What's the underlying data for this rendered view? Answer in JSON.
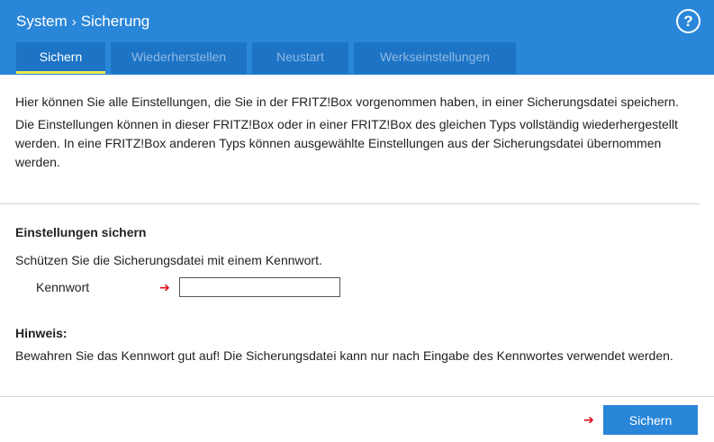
{
  "header": {
    "breadcrumb": [
      "System",
      "Sicherung"
    ],
    "help_glyph": "?"
  },
  "tabs": [
    {
      "label": "Sichern",
      "active": true
    },
    {
      "label": "Wiederherstellen",
      "active": false
    },
    {
      "label": "Neustart",
      "active": false
    },
    {
      "label": "Werkseinstellungen",
      "active": false
    }
  ],
  "intro": {
    "p1": "Hier können Sie alle Einstellungen, die Sie in der FRITZ!Box vorgenommen haben, in einer Sicherungsdatei speichern.",
    "p2": "Die Einstellungen können in dieser FRITZ!Box oder in einer FRITZ!Box des gleichen Typs vollständig wiederhergestellt werden. In eine FRITZ!Box anderen Typs können ausgewählte Einstellungen aus der Sicherungsdatei übernommen werden."
  },
  "backup": {
    "heading": "Einstellungen sichern",
    "description": "Schützen Sie die Sicherungsdatei mit einem Kennwort.",
    "password_label": "Kennwort",
    "password_value": ""
  },
  "hint": {
    "heading": "Hinweis:",
    "text": "Bewahren Sie das Kennwort gut auf! Die Sicherungsdatei kann nur nach Eingabe des Kennwortes verwendet werden."
  },
  "footer": {
    "save_button": "Sichern"
  },
  "icons": {
    "arrow": "arrow-right-icon",
    "help": "help-icon",
    "breadcrumb_separator": "chevron-right-icon"
  },
  "colors": {
    "header": "#2a86d8",
    "tab": "#1d74c5",
    "tab_active_underline": "#f0ec4a",
    "arrow": "#e3061b",
    "button": "#2a86d8"
  }
}
